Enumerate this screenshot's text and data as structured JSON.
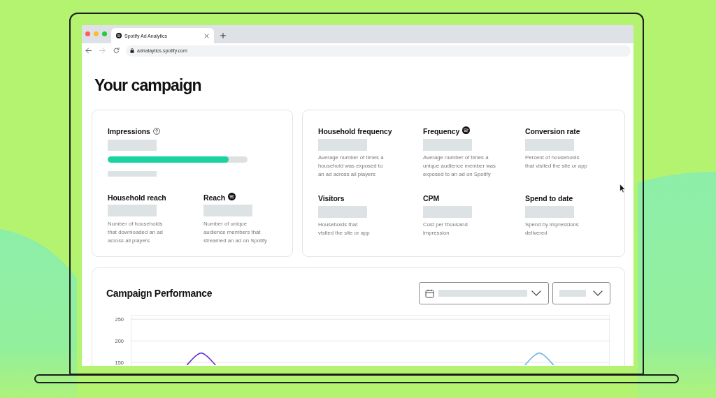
{
  "browser": {
    "tabs": [
      {
        "title": "Spotify Ad Analytics",
        "selected": true
      }
    ],
    "nav_buttons": [
      {
        "kind": "back",
        "disabled": false
      },
      {
        "kind": "forward",
        "disabled": true
      },
      {
        "kind": "reload",
        "disabled": false
      }
    ],
    "address": "adnalaytics.spotify.com"
  },
  "page": {
    "title": "Your campaign"
  },
  "impressions_card": {
    "label": "Impressions",
    "level": 0.865,
    "metrics": [
      {
        "kind": "standard",
        "label": "Household reach",
        "description": "Number of households\nthat downloaded an ad\nacross all players"
      },
      {
        "kind": "spotify",
        "label": "Reach",
        "description": "Number of unique\naudience members that\nstreamed an ad on Spotify"
      }
    ]
  },
  "metrics_card": {
    "metrics": [
      {
        "kind": "standard",
        "label": "Household frequency",
        "description": "Average number of times a\nhousehold was exposed to\nan ad across all players"
      },
      {
        "kind": "spotify",
        "label": "Frequency",
        "description": "Average number of times a\nunique audience member was\nexposed to an ad on Spotify"
      },
      {
        "kind": "standard",
        "label": "Conversion rate",
        "description": "Percent of households\nthat visited the site or app"
      },
      {
        "kind": "standard",
        "label": "Visitors",
        "description": "Households that\nvisited the site or app"
      },
      {
        "kind": "standard",
        "label": "CPM",
        "description": "Cost per thousand\nimpression"
      },
      {
        "kind": "standard",
        "label": "Spend to date",
        "description": "Spend by impressions\ndelivered"
      }
    ]
  },
  "performance": {
    "title": "Campaign Performance",
    "chart_data": {
      "type": "line",
      "grid": true,
      "ylim": [
        140,
        260
      ],
      "yticks": [
        150,
        200,
        250
      ],
      "series": [
        {
          "color": "#6a2fd0",
          "values": [
            null,
            null,
            null,
            null,
            145,
            172,
            145,
            null,
            null,
            null,
            null,
            null,
            null,
            null,
            null,
            null,
            null,
            null,
            null,
            null,
            null,
            null,
            null,
            null,
            null,
            null,
            null,
            null,
            null,
            null,
            null,
            null,
            null,
            null,
            null
          ]
        },
        {
          "color": "#6fb5e3",
          "values": [
            null,
            null,
            null,
            null,
            null,
            null,
            null,
            null,
            null,
            null,
            null,
            null,
            null,
            null,
            null,
            null,
            null,
            null,
            null,
            null,
            null,
            null,
            null,
            null,
            null,
            null,
            null,
            null,
            145,
            172,
            145,
            null,
            null,
            null,
            null
          ]
        }
      ]
    }
  }
}
